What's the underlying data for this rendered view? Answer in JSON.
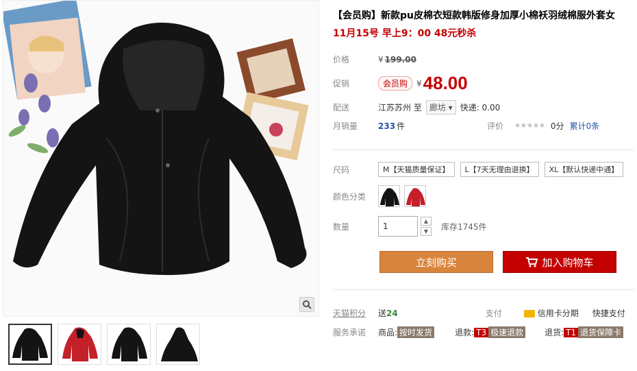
{
  "product": {
    "title": "【会员购】新款pu皮棉衣短款韩版修身加厚小棉袄羽绒棉服外套女",
    "promo": "11月15号 早上9：00 48元秒杀"
  },
  "price": {
    "label": "价格",
    "currency": "¥",
    "original": "199.00"
  },
  "sale": {
    "label": "促销",
    "tag": "会员购",
    "currency": "¥",
    "price": "48.00"
  },
  "shipping": {
    "label": "配送",
    "from": "江苏苏州 至",
    "to": "廊坊",
    "fee": "快递: 0.00"
  },
  "sales": {
    "label": "月销量",
    "count": "233",
    "unit": "件",
    "rating_label": "评价",
    "stars": "★★★★★",
    "score": "0分",
    "reviews": "累计0条"
  },
  "size": {
    "label": "尺码",
    "options": [
      "M【天猫质量保证】",
      "L【7天无理由退换】",
      "XL【默认快递中通】"
    ]
  },
  "color": {
    "label": "颜色分类"
  },
  "quantity": {
    "label": "数量",
    "value": "1",
    "stock": "库存1745件"
  },
  "buttons": {
    "buy": "立刻购买",
    "cart": "加入购物车"
  },
  "points": {
    "label": "天猫积分",
    "prefix": "送",
    "value": "24",
    "pay_label": "支付",
    "credit": "信用卡分期",
    "quick": "快捷支付"
  },
  "service": {
    "label": "服务承诺",
    "goods": "商品:",
    "goods_badge": "按时发货",
    "refund": "退款:",
    "refund_code": "T3",
    "refund_badge": "极速退款",
    "returns": "退货:",
    "returns_code": "T1",
    "returns_badge": "退货保障卡"
  },
  "colors": {
    "accent": "#c40000",
    "buy": "#d9843d"
  }
}
